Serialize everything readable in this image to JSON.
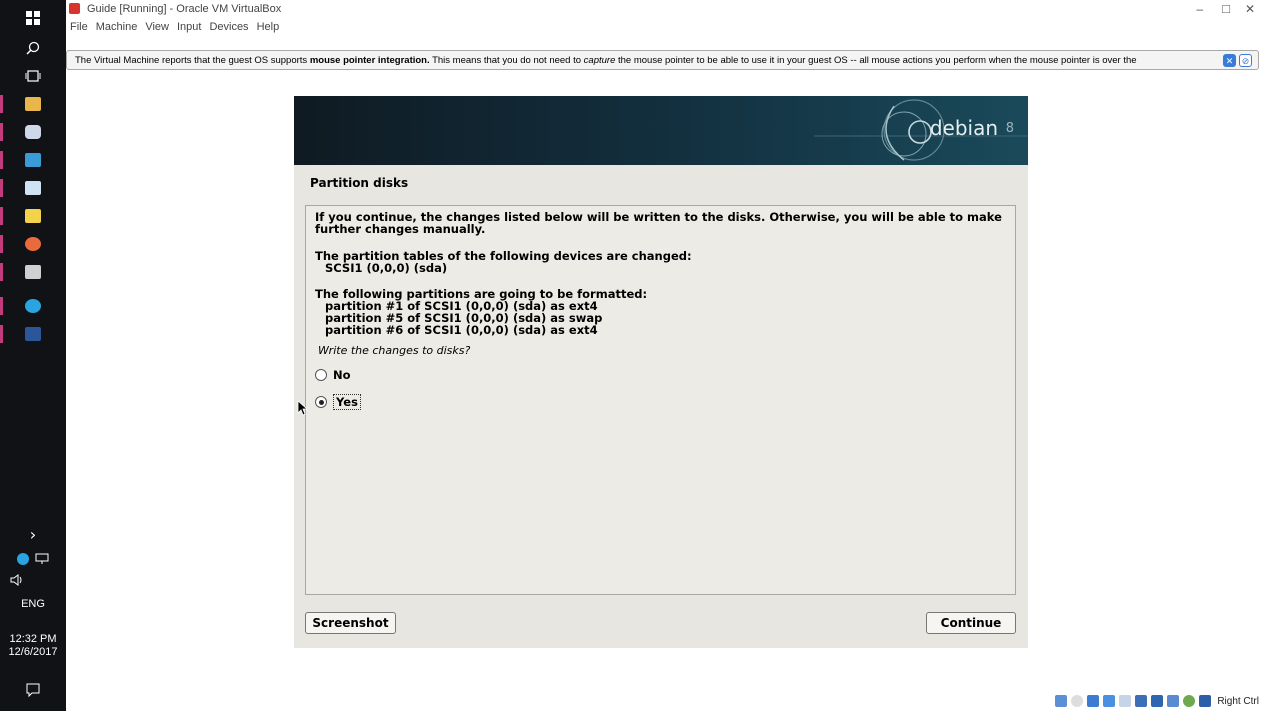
{
  "window": {
    "title": "Guide [Running] - Oracle VM VirtualBox",
    "controls": {
      "minimize": "–",
      "maximize": "□",
      "close": "✕"
    }
  },
  "menubar": {
    "items": [
      "File",
      "Machine",
      "View",
      "Input",
      "Devices",
      "Help"
    ]
  },
  "notice": {
    "pre": "The Virtual Machine reports that the guest OS supports ",
    "bold": "mouse pointer integration.",
    "mid": " This means that you do not need to ",
    "italic": "capture",
    "post": " the mouse pointer to be able to use it in your guest OS -- all mouse actions you perform when the mouse pointer is over the"
  },
  "installer": {
    "banner": {
      "logo_text": "debian",
      "version": "8"
    },
    "step_title": "Partition disks",
    "intro": "If you continue, the changes listed below will be written to the disks. Otherwise, you will be able to make further changes manually.",
    "tables_heading": "The partition tables of the following devices are changed:",
    "tables_device": "SCSI1 (0,0,0) (sda)",
    "format_heading": "The following partitions are going to be formatted:",
    "partitions": [
      "partition #1 of SCSI1 (0,0,0) (sda) as ext4",
      "partition #5 of SCSI1 (0,0,0) (sda) as swap",
      "partition #6 of SCSI1 (0,0,0) (sda) as ext4"
    ],
    "question": "Write the changes to disks?",
    "options": {
      "no": "No",
      "yes": "Yes",
      "selected": "Yes"
    },
    "buttons": {
      "screenshot": "Screenshot",
      "continue": "Continue"
    }
  },
  "statusbar": {
    "host_key": "Right Ctrl"
  },
  "taskbar": {
    "language": "ENG",
    "time": "12:32 PM",
    "date": "12/6/2017",
    "colors": {
      "windows": "#ffffff",
      "explorer": "#e8b64b",
      "app": "#e0e0e0",
      "rdp": "#3a9bd6",
      "files": "#cfe3f2",
      "notes": "#f2d34b",
      "paint": "#e96b3b",
      "term": "#d0d0d0",
      "telegram": "#2aa3e1",
      "word": "#2b579a"
    }
  },
  "colors": {
    "debian_banner": "#133141",
    "installer_bg": "#e8e6e0",
    "taskbar_bg": "#101216"
  }
}
